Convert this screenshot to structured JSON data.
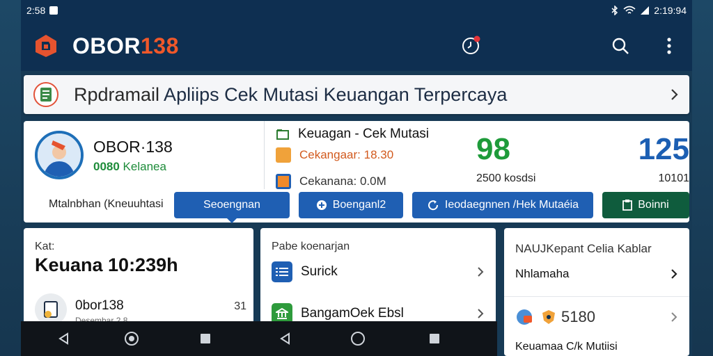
{
  "status_bar": {
    "time": "2:58",
    "clock_right": "2:19:94"
  },
  "app": {
    "title_main": "OBOR",
    "title_accent": "138"
  },
  "banner": {
    "lead": "Rpdramail",
    "text": " Apliips  Cek Mutasi Keuangan Terpercaya"
  },
  "profile": {
    "name": "OBOR·138",
    "badge": "0080",
    "badge_rest": " Kelanea"
  },
  "keuangan": {
    "title": "Keuagan - Cek Mutasi",
    "line1": "Cekangaar: 18.30",
    "line2": "Cekanana: 0.0M",
    "stat1": "98",
    "stat1_sub": "2500 kosdsi",
    "stat2": "125",
    "stat2_sub": "10101"
  },
  "tabs": {
    "plain": "Mtalnbhan (Kneuuhtasi",
    "t1": "Seoengnan",
    "t2": "Boenganl2",
    "t3": "Ieodaegnnen /Hek Mutaéia",
    "t4": "Boinni"
  },
  "card_left": {
    "label": "Kat:",
    "value": "Keuana 10:239h",
    "row_name": "0bor138",
    "row_count": "31",
    "row_sub": "Desembar 2.8"
  },
  "card_mid": {
    "title": "Pabe koenarjan",
    "items": [
      {
        "label": "Surick"
      },
      {
        "label": "BangamOek Ebsl"
      }
    ]
  },
  "card_right": {
    "title": "NAUJKepant Celia Kablar",
    "item1": "Nhlamaha",
    "stat": "5180",
    "footer": "Keuamaa C/k Mutiisi"
  },
  "colors": {
    "appbar": "#0e2f51",
    "accent_orange": "#f0582a",
    "primary_blue": "#1f5fb3",
    "green": "#1e9b3a"
  }
}
